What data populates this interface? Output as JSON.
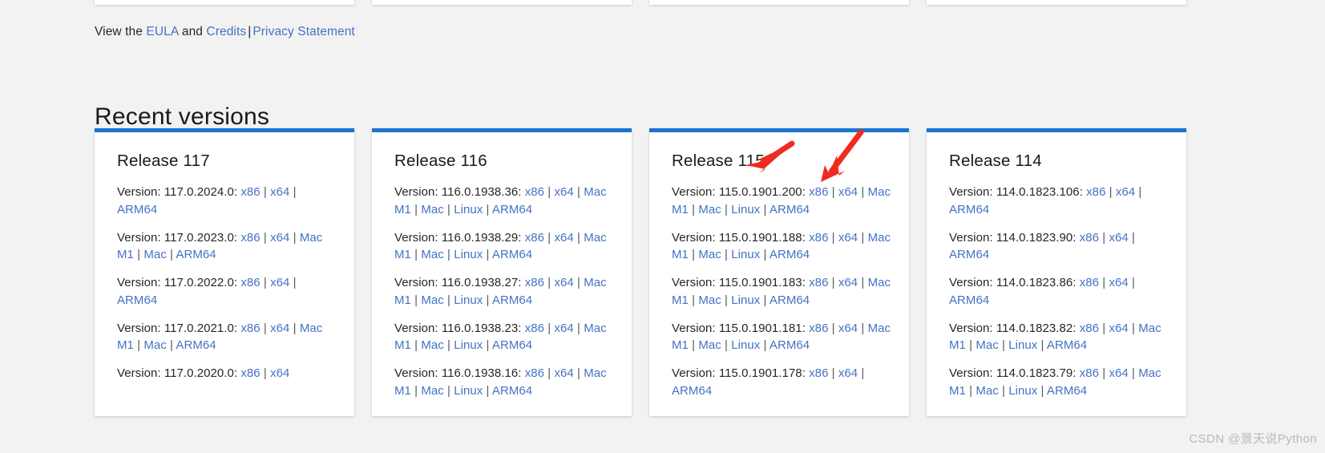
{
  "legal": {
    "prefix": "View the ",
    "eula_label": "EULA",
    "middle": " and ",
    "credits_label": "Credits",
    "separator": "|",
    "privacy_label": "Privacy Statement"
  },
  "section": {
    "title": "Recent versions"
  },
  "colors": {
    "accent_bar": "#1b74cd",
    "link": "#4472c4",
    "page_background": "#f2f2f2",
    "card_background": "#ffffff",
    "annotation_arrow": "#ee2b20",
    "watermark": "#b9b9b9"
  },
  "version_prefix": "Version: ",
  "cards": [
    {
      "title": "Release 117",
      "versions": [
        {
          "version": "117.0.2024.0",
          "links": [
            "x86",
            "x64",
            "ARM64"
          ]
        },
        {
          "version": "117.0.2023.0",
          "links": [
            "x86",
            "x64",
            "Mac M1",
            "Mac",
            "ARM64"
          ]
        },
        {
          "version": "117.0.2022.0",
          "links": [
            "x86",
            "x64",
            "ARM64"
          ]
        },
        {
          "version": "117.0.2021.0",
          "links": [
            "x86",
            "x64",
            "Mac M1",
            "Mac",
            "ARM64"
          ]
        },
        {
          "version": "117.0.2020.0",
          "links": [
            "x86",
            "x64"
          ]
        }
      ]
    },
    {
      "title": "Release 116",
      "versions": [
        {
          "version": "116.0.1938.36",
          "links": [
            "x86",
            "x64",
            "Mac M1",
            "Mac",
            "Linux",
            "ARM64"
          ]
        },
        {
          "version": "116.0.1938.29",
          "links": [
            "x86",
            "x64",
            "Mac M1",
            "Mac",
            "Linux",
            "ARM64"
          ]
        },
        {
          "version": "116.0.1938.27",
          "links": [
            "x86",
            "x64",
            "Mac M1",
            "Mac",
            "Linux",
            "ARM64"
          ]
        },
        {
          "version": "116.0.1938.23",
          "links": [
            "x86",
            "x64",
            "Mac M1",
            "Mac",
            "Linux",
            "ARM64"
          ]
        },
        {
          "version": "116.0.1938.16",
          "links": [
            "x86",
            "x64",
            "Mac M1",
            "Mac",
            "Linux",
            "ARM64"
          ]
        }
      ]
    },
    {
      "title": "Release 115",
      "versions": [
        {
          "version": "115.0.1901.200",
          "links": [
            "x86",
            "x64",
            "Mac M1",
            "Mac",
            "Linux",
            "ARM64"
          ]
        },
        {
          "version": "115.0.1901.188",
          "links": [
            "x86",
            "x64",
            "Mac M1",
            "Mac",
            "Linux",
            "ARM64"
          ]
        },
        {
          "version": "115.0.1901.183",
          "links": [
            "x86",
            "x64",
            "Mac M1",
            "Mac",
            "Linux",
            "ARM64"
          ]
        },
        {
          "version": "115.0.1901.181",
          "links": [
            "x86",
            "x64",
            "Mac M1",
            "Mac",
            "Linux",
            "ARM64"
          ]
        },
        {
          "version": "115.0.1901.178",
          "links": [
            "x86",
            "x64",
            "ARM64"
          ]
        }
      ]
    },
    {
      "title": "Release 114",
      "versions": [
        {
          "version": "114.0.1823.106",
          "links": [
            "x86",
            "x64",
            "ARM64"
          ]
        },
        {
          "version": "114.0.1823.90",
          "links": [
            "x86",
            "x64",
            "ARM64"
          ]
        },
        {
          "version": "114.0.1823.86",
          "links": [
            "x86",
            "x64",
            "ARM64"
          ]
        },
        {
          "version": "114.0.1823.82",
          "links": [
            "x86",
            "x64",
            "Mac M1",
            "Mac",
            "Linux",
            "ARM64"
          ]
        },
        {
          "version": "114.0.1823.79",
          "links": [
            "x86",
            "x64",
            "Mac M1",
            "Mac",
            "Linux",
            "ARM64"
          ]
        }
      ]
    }
  ],
  "annotations": [
    {
      "name": "arrow-to-release-115-title"
    },
    {
      "name": "arrow-to-x64-link"
    }
  ],
  "watermark": {
    "text": "CSDN @景天说Python"
  }
}
